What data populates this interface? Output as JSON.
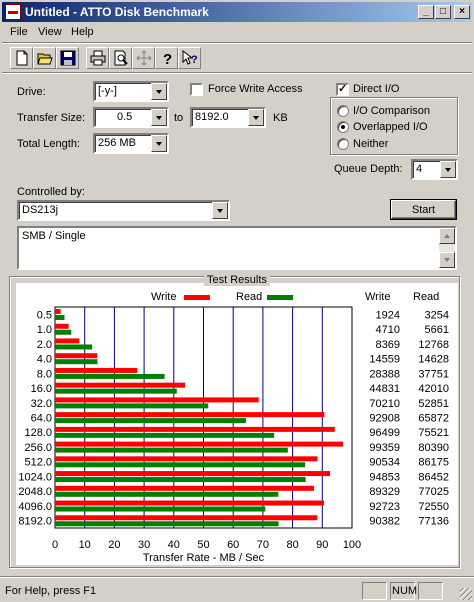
{
  "window": {
    "title": "Untitled - ATTO Disk Benchmark"
  },
  "menu": [
    "File",
    "View",
    "Help"
  ],
  "toolbar": [
    "new-icon",
    "open-icon",
    "save-icon",
    "print-icon",
    "print-preview-icon",
    "move-icon",
    "help-icon",
    "context-help-icon"
  ],
  "form": {
    "drive_label": "Drive:",
    "drive_value": "[-y-]",
    "transfer_label": "Transfer Size:",
    "transfer_from": "0.5",
    "to_label": "to",
    "transfer_to": "8192.0",
    "kb_label": "KB",
    "length_label": "Total Length:",
    "length_value": "256 MB",
    "force_write_label": "Force Write Access",
    "force_write_checked": false,
    "direct_io_label": "Direct I/O",
    "direct_io_checked": true,
    "io_comparison_label": "I/O Comparison",
    "overlapped_io_label": "Overlapped I/O",
    "neither_label": "Neither",
    "selected_mode": "Overlapped I/O",
    "queue_depth_label": "Queue Depth:",
    "queue_depth_value": "4",
    "controlled_by_label": "Controlled by:",
    "controlled_by_value": "DS213j",
    "start_label": "Start",
    "description": "SMB / Single"
  },
  "results": {
    "title": "Test Results",
    "write_legend": "Write",
    "read_legend": "Read",
    "write_header": "Write",
    "read_header": "Read"
  },
  "chart_data": {
    "type": "bar",
    "orientation": "horizontal",
    "title": "Test Results",
    "xlabel": "Transfer Rate - MB / Sec",
    "xlim": [
      0,
      100
    ],
    "xticks": [
      "0",
      "10",
      "20",
      "30",
      "40",
      "50",
      "60",
      "70",
      "80",
      "90",
      "100"
    ],
    "categories": [
      "0.5",
      "1.0",
      "2.0",
      "4.0",
      "8.0",
      "16.0",
      "32.0",
      "64.0",
      "128.0",
      "256.0",
      "512.0",
      "1024.0",
      "2048.0",
      "4096.0",
      "8192.0"
    ],
    "series": [
      {
        "name": "Write",
        "color": "#ff0000",
        "values": [
          1.9,
          4.6,
          8.2,
          14.2,
          27.7,
          43.8,
          68.6,
          90.7,
          94.2,
          97.0,
          88.4,
          92.6,
          87.2,
          90.6,
          88.3
        ],
        "labels": [
          "1924",
          "4710",
          "8369",
          "14559",
          "28388",
          "44831",
          "70210",
          "92908",
          "96499",
          "99359",
          "90534",
          "94853",
          "89329",
          "92723",
          "90382"
        ]
      },
      {
        "name": "Read",
        "color": "#008000",
        "values": [
          3.2,
          5.5,
          12.5,
          14.3,
          36.9,
          41.0,
          51.6,
          64.3,
          73.8,
          78.4,
          84.2,
          84.4,
          75.2,
          70.8,
          75.3
        ],
        "labels": [
          "3254",
          "5661",
          "12768",
          "14628",
          "37751",
          "42010",
          "52851",
          "65872",
          "75521",
          "80390",
          "86175",
          "86452",
          "77025",
          "72550",
          "77136"
        ]
      }
    ],
    "grid": true,
    "legend": "top"
  },
  "status": {
    "help_text": "For Help, press F1",
    "num": "NUM"
  }
}
